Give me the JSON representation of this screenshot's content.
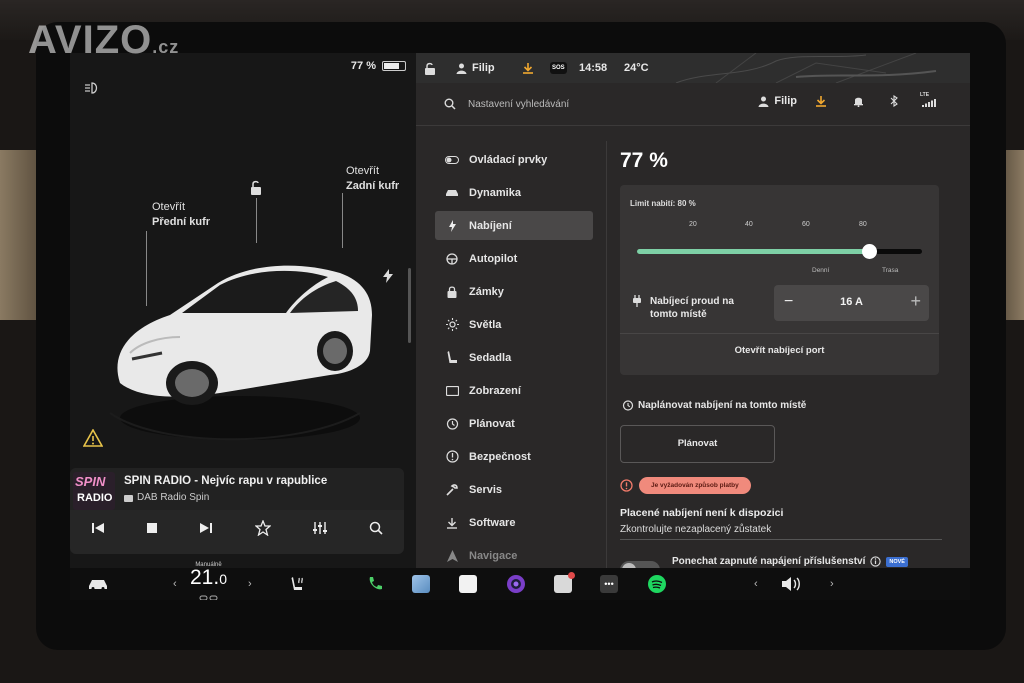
{
  "watermark": {
    "text": "AVIZO",
    "suffix": ".cz"
  },
  "status": {
    "battery": "77 %",
    "battery_level": 0.77
  },
  "car": {
    "front_trunk_action": "Otevřít",
    "front_trunk_name": "Přední kufr",
    "rear_trunk_action": "Otevřít",
    "rear_trunk_name": "Zadní kufr"
  },
  "media": {
    "logo_top": "SPIN",
    "logo_bottom": "RADIO",
    "title": "SPIN RADIO - Nejvíc rapu v rapublice",
    "source": "DAB Radio Spin"
  },
  "topbar": {
    "user": "Filip",
    "time": "14:58",
    "temperature": "24°C",
    "sos": "SOS"
  },
  "search": {
    "placeholder": "Nastavení vyhledávání"
  },
  "header": {
    "user": "Filip",
    "lte": "LTE"
  },
  "nav": {
    "items": [
      {
        "label": "Ovládací prvky"
      },
      {
        "label": "Dynamika"
      },
      {
        "label": "Nabíjení"
      },
      {
        "label": "Autopilot"
      },
      {
        "label": "Zámky"
      },
      {
        "label": "Světla"
      },
      {
        "label": "Sedadla"
      },
      {
        "label": "Zobrazení"
      },
      {
        "label": "Plánovat"
      },
      {
        "label": "Bezpečnost"
      },
      {
        "label": "Servis"
      },
      {
        "label": "Software"
      },
      {
        "label": "Navigace"
      }
    ]
  },
  "charging": {
    "percent": "77 %",
    "limit_label": "Limit nabití: 80 %",
    "limit_value": 80,
    "ticks": [
      "20",
      "40",
      "60",
      "80"
    ],
    "daily_label": "Denní",
    "trip_label": "Trasa",
    "current_label_1": "Nabíjecí proud na",
    "current_label_2": "tomto místě",
    "current_value": "16 A",
    "minus": "−",
    "plus": "+",
    "open_port": "Otevřít nabíjecí port",
    "schedule_title": "Naplánovat nabíjení na tomto místě",
    "plan_button": "Plánovat",
    "payment_error": "Je vyžadován způsob platby",
    "paid_title": "Placené nabíjení není k dispozici",
    "paid_sub": "Zkontrolujte nezaplacený zůstatek",
    "accessory_label": "Ponechat zapnuté napájení příslušenství",
    "new_badge": "NOVÉ"
  },
  "dock": {
    "climate_mode": "Manuálně",
    "temp_int": "21.",
    "temp_dec": "0"
  }
}
